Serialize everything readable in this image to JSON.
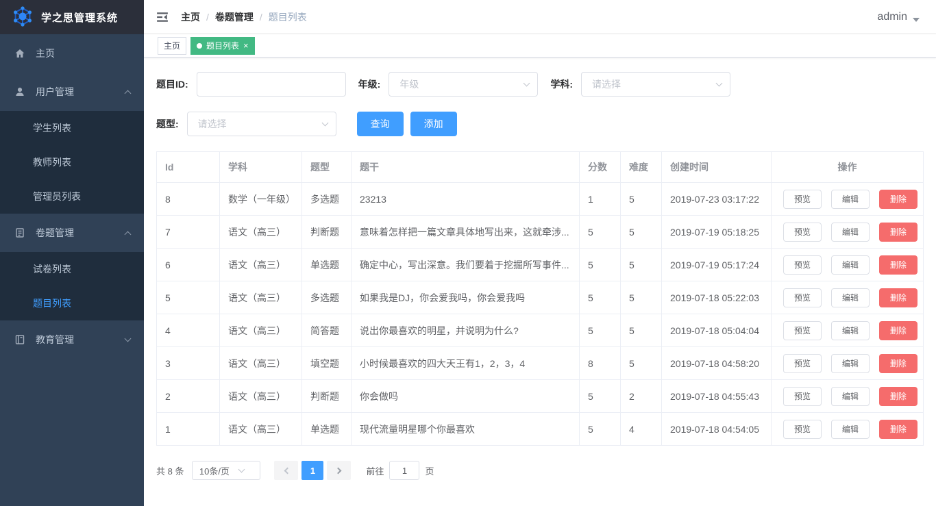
{
  "app": {
    "title": "学之思管理系统",
    "user": "admin"
  },
  "colors": {
    "primary": "#409EFF",
    "tag_active_green": "#42B983",
    "danger": "#F56C6C",
    "sidebar_bg": "#304156",
    "submenu_bg": "#1F2D3D",
    "logo_bar_bg": "#2B2F3A",
    "active_menu_text": "#409EFF"
  },
  "sidebar": {
    "items": [
      {
        "label": "主页",
        "icon": "home-icon",
        "level": 1
      },
      {
        "label": "用户管理",
        "icon": "user-icon",
        "level": 1,
        "expanded": true
      },
      {
        "label": "学生列表",
        "level": 2
      },
      {
        "label": "教师列表",
        "level": 2
      },
      {
        "label": "管理员列表",
        "level": 2
      },
      {
        "label": "卷题管理",
        "icon": "document-icon",
        "level": 1,
        "expanded": true
      },
      {
        "label": "试卷列表",
        "level": 2
      },
      {
        "label": "题目列表",
        "level": 2,
        "active": true
      },
      {
        "label": "教育管理",
        "icon": "book-icon",
        "level": 1,
        "expanded": false
      }
    ]
  },
  "breadcrumb": {
    "items": [
      "主页",
      "卷题管理",
      "题目列表"
    ]
  },
  "tags": [
    {
      "label": "主页",
      "active": false
    },
    {
      "label": "题目列表",
      "active": true,
      "closable": true
    }
  ],
  "filters": {
    "question_id": {
      "label": "题目ID:",
      "value": ""
    },
    "grade": {
      "label": "年级:",
      "placeholder": "年级"
    },
    "subject": {
      "label": "学科:",
      "placeholder": "请选择"
    },
    "question_type": {
      "label": "题型:",
      "placeholder": "请选择"
    },
    "search_label": "查询",
    "add_label": "添加"
  },
  "table": {
    "headers": [
      "Id",
      "学科",
      "题型",
      "题干",
      "分数",
      "难度",
      "创建时间",
      "操作"
    ],
    "actions": [
      "预览",
      "编辑",
      "删除"
    ],
    "rows": [
      {
        "id": "8",
        "subject": "数学（一年级）",
        "type": "多选题",
        "stem": "23213",
        "score": "1",
        "difficulty": "5",
        "created": "2019-07-23 03:17:22"
      },
      {
        "id": "7",
        "subject": "语文（高三）",
        "type": "判断题",
        "stem": "意味着怎样把一篇文章具体地写出来，这就牵涉...",
        "score": "5",
        "difficulty": "5",
        "created": "2019-07-19 05:18:25"
      },
      {
        "id": "6",
        "subject": "语文（高三）",
        "type": "单选题",
        "stem": "确定中心，写出深意。我们要着于挖掘所写事件...",
        "score": "5",
        "difficulty": "5",
        "created": "2019-07-19 05:17:24"
      },
      {
        "id": "5",
        "subject": "语文（高三）",
        "type": "多选题",
        "stem": "如果我是DJ，你会爱我吗，你会爱我吗",
        "score": "5",
        "difficulty": "5",
        "created": "2019-07-18 05:22:03"
      },
      {
        "id": "4",
        "subject": "语文（高三）",
        "type": "简答题",
        "stem": "说出你最喜欢的明星，并说明为什么?",
        "score": "5",
        "difficulty": "5",
        "created": "2019-07-18 05:04:04"
      },
      {
        "id": "3",
        "subject": "语文（高三）",
        "type": "填空题",
        "stem": "小时候最喜欢的四大天王有1，2，3，4",
        "score": "8",
        "difficulty": "5",
        "created": "2019-07-18 04:58:20"
      },
      {
        "id": "2",
        "subject": "语文（高三）",
        "type": "判断题",
        "stem": "你会做吗",
        "score": "5",
        "difficulty": "2",
        "created": "2019-07-18 04:55:43"
      },
      {
        "id": "1",
        "subject": "语文（高三）",
        "type": "单选题",
        "stem": "现代流量明星哪个你最喜欢",
        "score": "5",
        "difficulty": "4",
        "created": "2019-07-18 04:54:05"
      }
    ]
  },
  "pagination": {
    "total_text": "共 8 条",
    "page_size": "10条/页",
    "current_page": "1",
    "goto_label": "前往",
    "goto_value": "1",
    "page_suffix": "页"
  }
}
